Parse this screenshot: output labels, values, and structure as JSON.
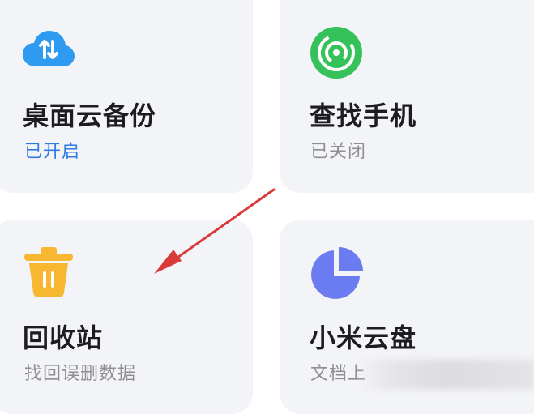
{
  "cards": [
    {
      "id": "desktop-backup",
      "title": "桌面云备份",
      "status": "已开启",
      "icon": "cloud-sync-icon",
      "icon_color": "#2e9bf0",
      "status_color": "#2e7be0"
    },
    {
      "id": "find-phone",
      "title": "查找手机",
      "status": "已关闭",
      "icon": "radar-icon",
      "icon_color": "#35c25a",
      "status_color": "#8e8e93"
    },
    {
      "id": "recycle-bin",
      "title": "回收站",
      "status": "找回误删数据",
      "icon": "trash-icon",
      "icon_color": "#f7b731",
      "status_color": "#8e8e93"
    },
    {
      "id": "mi-cloud-drive",
      "title": "小米云盘",
      "status": "文档上",
      "icon": "pie-chart-icon",
      "icon_color": "#6b7cf0",
      "status_color": "#8e8e93"
    }
  ],
  "annotation": {
    "icon": "red-arrow",
    "color": "#d93a3a"
  }
}
